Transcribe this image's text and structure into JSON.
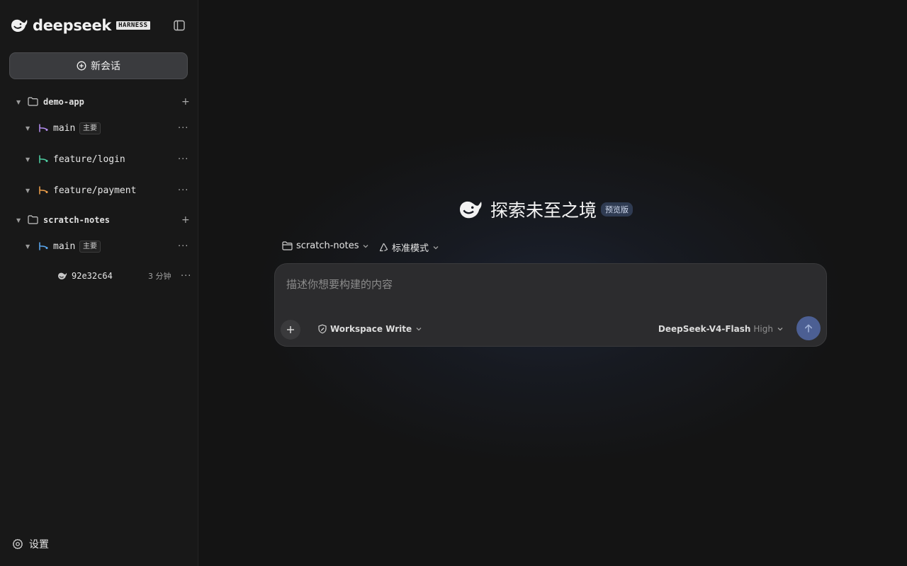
{
  "brand": {
    "name": "deepseek",
    "badge": "HARNESS"
  },
  "sidebar": {
    "new_chat_label": "新会话",
    "projects": [
      {
        "name": "demo-app",
        "branches": [
          {
            "name": "main",
            "tag": "主要",
            "color": "#b48ef0"
          },
          {
            "name": "feature/login",
            "color": "#4fd1a5"
          },
          {
            "name": "feature/payment",
            "color": "#f0a04a"
          }
        ]
      },
      {
        "name": "scratch-notes",
        "branches": [
          {
            "name": "main",
            "tag": "主要",
            "color": "#5aa8f0"
          }
        ],
        "session": {
          "id": "92e32c64",
          "time": "3 分钟"
        }
      }
    ],
    "settings_label": "设置"
  },
  "main": {
    "hero_title": "探索未至之境",
    "hero_badge": "预览版",
    "workspace_selector": "scratch-notes",
    "mode_selector": "标准模式",
    "composer": {
      "placeholder": "描述你想要构建的内容",
      "permission": "Workspace Write",
      "model": "DeepSeek-V4-Flash",
      "level": "High"
    }
  },
  "colors": {
    "accent": "#4c5f93",
    "background": "#141414",
    "sidebar": "#181818"
  }
}
